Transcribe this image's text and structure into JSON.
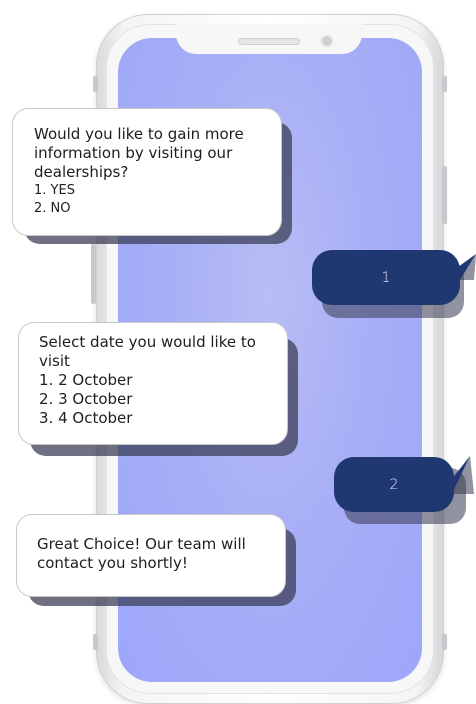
{
  "chat": {
    "messages": [
      {
        "from": "bot",
        "lines": [
          "Would you like to gain more",
          "information by visiting our",
          "dealerships?",
          "1. YES",
          "2. NO"
        ]
      },
      {
        "from": "user",
        "text": "1"
      },
      {
        "from": "bot",
        "lines": [
          "Select date you would like to",
          "visit",
          "1. 2 October",
          "2. 3 October",
          "3. 4 October"
        ]
      },
      {
        "from": "user",
        "text": "2"
      },
      {
        "from": "bot",
        "lines": [
          "Great Choice! Our team will",
          "contact you shortly!"
        ]
      }
    ]
  },
  "colors": {
    "screen": "#a8aff6",
    "user_bubble": "#1f3872",
    "bot_bubble": "#ffffff",
    "bubble_shadow": "#373a52"
  }
}
